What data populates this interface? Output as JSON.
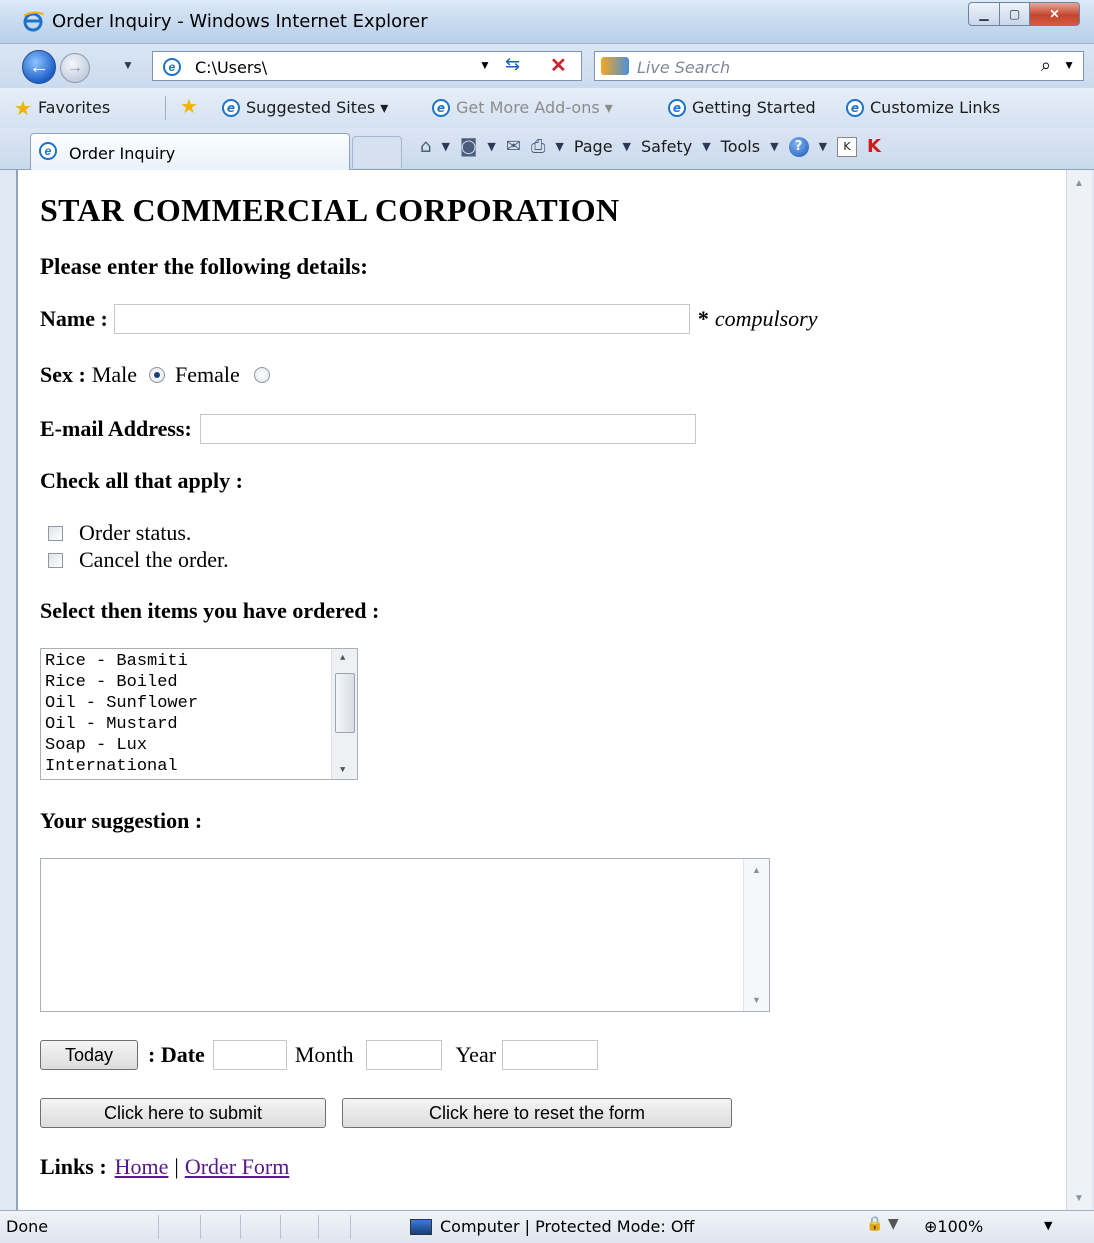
{
  "window": {
    "title": "Order Inquiry - Windows Internet Explorer"
  },
  "address_bar": {
    "url": "C:\\Users\\",
    "search_placeholder": "Live Search"
  },
  "favorites_bar": {
    "favorites_label": "Favorites",
    "items": [
      "Suggested Sites ▾",
      "Get More Add-ons ▾",
      "Getting Started",
      "Customize Links"
    ]
  },
  "tabs": {
    "active_label": "Order Inquiry"
  },
  "command_bar": {
    "page": "Page",
    "safety": "Safety",
    "tools": "Tools"
  },
  "form": {
    "company": "STAR COMMERCIAL CORPORATION",
    "intro": "Please enter the following details:",
    "name_label": "Name :",
    "name_value": "",
    "compulsory_star": "*",
    "compulsory_text": "compulsory",
    "sex_label": "Sex :",
    "sex_options": [
      "Male",
      "Female"
    ],
    "sex_selected": "Male",
    "email_label": "E-mail Address:",
    "email_value": "",
    "check_heading": "Check all that apply :",
    "checkboxes": [
      "Order status.",
      "Cancel the order."
    ],
    "items_heading": "Select then items you have ordered :",
    "items_options": [
      "Rice - Basmiti",
      "Rice - Boiled",
      "Oil - Sunflower",
      "Oil - Mustard",
      "Soap - Lux",
      "International"
    ],
    "suggestion_heading": "Your suggestion :",
    "suggestion_value": "",
    "today_button": "Today",
    "date_label": ": Date",
    "month_label": "Month",
    "year_label": "Year",
    "submit_button": "Click here to submit",
    "reset_button": "Click here to reset the form",
    "links_label": "Links :",
    "link_home": "Home",
    "link_separator": "|",
    "link_order_form": "Order Form"
  },
  "status_bar": {
    "status": "Done",
    "zone": "Computer | Protected Mode: Off",
    "zoom": "100%"
  },
  "colors": {
    "link_visited": "#551a8b",
    "close_button": "#c4452f",
    "title_bar": "#c5d8ef"
  }
}
